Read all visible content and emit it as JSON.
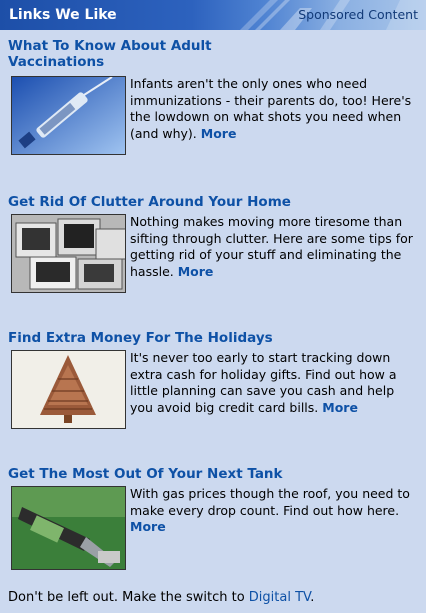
{
  "header": {
    "title": "Links We Like",
    "sponsored": "Sponsored Content"
  },
  "articles": [
    {
      "title": "What To Know About Adult Vaccinations",
      "body": "Infants aren't the only ones who need immunizations - their parents do, too! Here's the lowdown on what shots you need when (and why).",
      "more": "More",
      "image_icon": "syringe-icon"
    },
    {
      "title": "Get Rid Of Clutter Around Your Home",
      "body": "Nothing makes moving more tiresome than sifting through clutter. Here are some tips for getting rid of your stuff and eliminating the hassle.",
      "more": "More",
      "image_icon": "computer-monitors-icon"
    },
    {
      "title": "Find Extra Money For The Holidays",
      "body": "It's never too early to start tracking down extra cash for holiday gifts. Find out how a little planning can save you cash and help you avoid big credit card bills.",
      "more": "More",
      "image_icon": "money-tree-icon"
    },
    {
      "title": "Get The Most Out Of Your Next Tank",
      "body": "With gas prices though the roof, you need to make every drop count. Find out how here.",
      "more": "More",
      "image_icon": "gas-nozzle-icon"
    }
  ],
  "footer": {
    "text": "Don't be left out. Make the switch to ",
    "link": "Digital TV",
    "end": "."
  }
}
